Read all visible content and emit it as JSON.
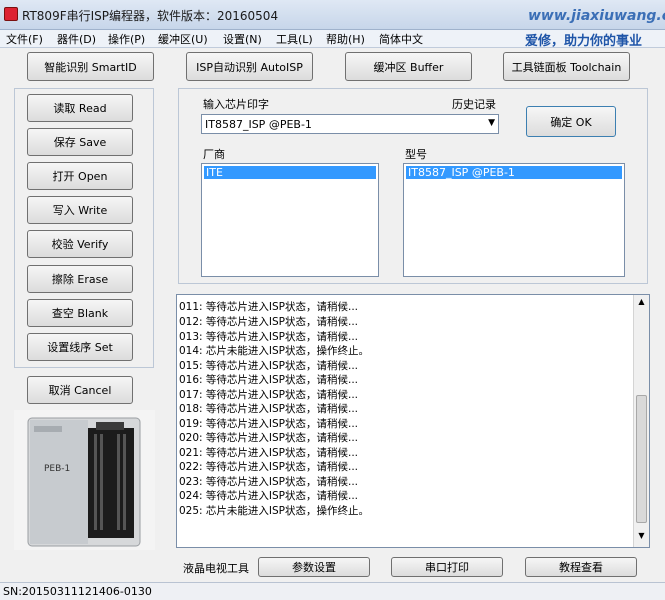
{
  "window": {
    "title": "RT809F串行ISP编程器，软件版本：20160504",
    "watermark": "www.jiaxiuwang.com"
  },
  "menu": [
    "文件(F)",
    "器件(D)",
    "操作(P)",
    "缓冲区(U)",
    "设置(N)",
    "工具(L)",
    "帮助(H)",
    "简体中文"
  ],
  "slogan": "爱修，助力你的事业",
  "top_buttons": [
    "智能识别 SmartID",
    "ISP自动识别 AutoISP",
    "缓冲区 Buffer",
    "工具链面板 Toolchain"
  ],
  "side_buttons": [
    "读取 Read",
    "保存 Save",
    "打开 Open",
    "写入 Write",
    "校验 Verify",
    "擦除 Erase",
    "查空 Blank",
    "设置线序 Set"
  ],
  "cancel_button": "取消 Cancel",
  "chip": {
    "input_label": "输入芯片印字",
    "history_label": "历史记录",
    "input_value": "IT8587_ISP @PEB-1",
    "ok_button": "确定 OK",
    "vendor_label": "厂商",
    "vendor_selected": "ITE",
    "model_label": "型号",
    "model_selected": "IT8587_ISP @PEB-1"
  },
  "image": {
    "label": "PEB-1"
  },
  "log_lines": [
    "011: 等待芯片进入ISP状态，请稍候...",
    "012: 等待芯片进入ISP状态，请稍候...",
    "013: 等待芯片进入ISP状态，请稍候...",
    "014: 芯片未能进入ISP状态，操作终止。",
    "015: 等待芯片进入ISP状态，请稍候...",
    "016: 等待芯片进入ISP状态，请稍候...",
    "017: 等待芯片进入ISP状态，请稍候...",
    "018: 等待芯片进入ISP状态，请稍候...",
    "019: 等待芯片进入ISP状态，请稍候...",
    "020: 等待芯片进入ISP状态，请稍候...",
    "021: 等待芯片进入ISP状态，请稍候...",
    "022: 等待芯片进入ISP状态，请稍候...",
    "023: 等待芯片进入ISP状态，请稍候...",
    "024: 等待芯片进入ISP状态，请稍候...",
    "025: 芯片未能进入ISP状态，操作终止。"
  ],
  "bottom": {
    "label": "液晶电视工具",
    "buttons": [
      "参数设置",
      "串口打印",
      "教程查看"
    ]
  },
  "status": "SN:20150311121406-0130"
}
